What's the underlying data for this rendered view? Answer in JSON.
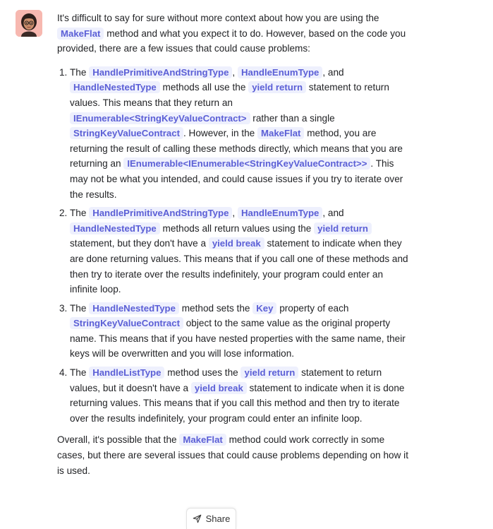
{
  "message": {
    "intro": {
      "t1": "It's difficult to say for sure without more context about how you are using the ",
      "c1": "MakeFlat",
      "t2": " method and what you expect it to do. However, based on the code you provided, there are a few issues that could cause problems:"
    },
    "items": [
      {
        "num": "1.",
        "t1": "The ",
        "c1": "HandlePrimitiveAndStringType",
        "t2": ", ",
        "c2": "HandleEnumType",
        "t3": ", and ",
        "c3": "HandleNestedType",
        "t4": " methods all use the ",
        "c4": "yield return",
        "t5": " statement to return values. This means that they return an ",
        "c5": "IEnumerable<StringKeyValueContract>",
        "t6": " rather than a single ",
        "c6": "StringKeyValueContract",
        "t7": ". However, in the ",
        "c7": "MakeFlat",
        "t8": " method, you are returning the result of calling these methods directly, which means that you are returning an ",
        "c8": "IEnumerable<IEnumerable<StringKeyValueContract>>",
        "t9": ". This may not be what you intended, and could cause issues if you try to iterate over the results."
      },
      {
        "num": "2.",
        "t1": "The ",
        "c1": "HandlePrimitiveAndStringType",
        "t2": ", ",
        "c2": "HandleEnumType",
        "t3": ", and ",
        "c3": "HandleNestedType",
        "t4": " methods all return values using the ",
        "c4": "yield return",
        "t5": " statement, but they don't have a ",
        "c5": "yield break",
        "t6": " statement to indicate when they are done returning values. This means that if you call one of these methods and then try to iterate over the results indefinitely, your program could enter an infinite loop."
      },
      {
        "num": "3.",
        "t1": "The ",
        "c1": "HandleNestedType",
        "t2": " method sets the ",
        "c2": "Key",
        "t3": " property of each ",
        "c3": "StringKeyValueContract",
        "t4": " object to the same value as the original property name. This means that if you have nested properties with the same name, their keys will be overwritten and you will lose information."
      },
      {
        "num": "4.",
        "t1": "The ",
        "c1": "HandleListType",
        "t2": " method uses the ",
        "c2": "yield return",
        "t3": " statement to return values, but it doesn't have a ",
        "c3": "yield break",
        "t4": " statement to indicate when it is done returning values. This means that if you call this method and then try to iterate over the results indefinitely, your program could enter an infinite loop."
      }
    ],
    "outro": {
      "t1": "Overall, it's possible that the ",
      "c1": "MakeFlat",
      "t2": " method could work correctly in some cases, but there are several issues that could cause problems depending on how it is used."
    }
  },
  "share": {
    "label": "Share",
    "icon": "share-icon"
  },
  "colors": {
    "code_text": "#5b5fd6",
    "code_bg": "#eef0fd",
    "avatar_bg": "#f7b8b0"
  }
}
